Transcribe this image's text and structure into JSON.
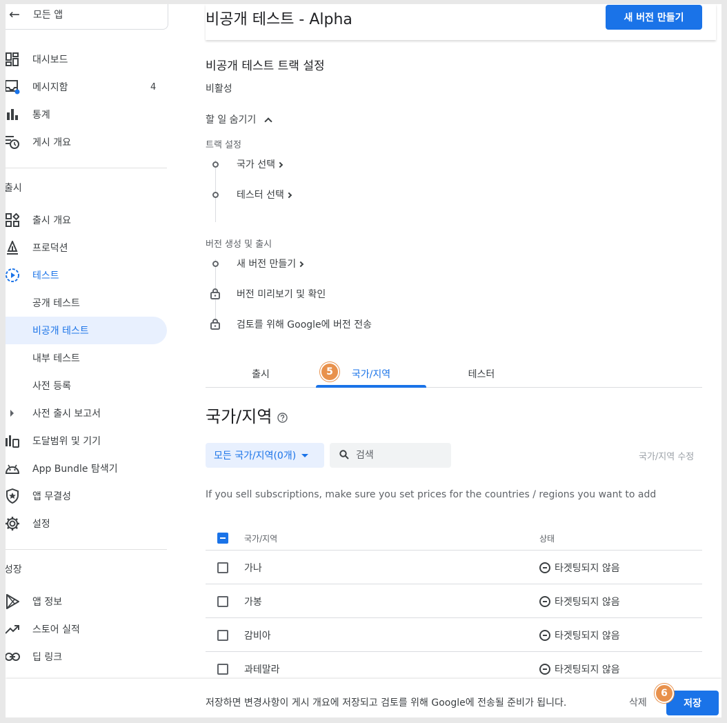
{
  "sidebar": {
    "back_label": "모든 앱",
    "items_top": [
      {
        "label": "대시보드",
        "icon": "dashboard-icon"
      },
      {
        "label": "메시지함",
        "icon": "inbox-icon",
        "badge": "4"
      },
      {
        "label": "통계",
        "icon": "bar-chart-icon"
      },
      {
        "label": "게시 개요",
        "icon": "publishing-overview-icon"
      }
    ],
    "section_release": "출시",
    "items_release": [
      {
        "label": "출시 개요",
        "icon": "release-overview-icon"
      },
      {
        "label": "프로덕션",
        "icon": "production-icon"
      },
      {
        "label": "테스트",
        "icon": "testing-icon"
      },
      {
        "label": "공개 테스트"
      },
      {
        "label": "비공개 테스트"
      },
      {
        "label": "내부 테스트"
      },
      {
        "label": "사전 등록"
      },
      {
        "label": "사전 출시 보고서"
      },
      {
        "label": "도달범위 및 기기",
        "icon": "reach-devices-icon"
      },
      {
        "label": "App Bundle 탐색기",
        "icon": "android-icon"
      },
      {
        "label": "앱 무결성",
        "icon": "shield-icon"
      },
      {
        "label": "설정",
        "icon": "gear-icon"
      }
    ],
    "section_grow": "성장",
    "items_grow": [
      {
        "label": "앱 정보",
        "icon": "play-icon"
      },
      {
        "label": "스토어 실적",
        "icon": "trending-icon"
      },
      {
        "label": "딥 링크",
        "icon": "link-icon"
      }
    ]
  },
  "header": {
    "title": "비공개 테스트 - Alpha",
    "new_release_button": "새 버전 만들기"
  },
  "track": {
    "title": "비공개 테스트 트랙 설정",
    "status": "비활성",
    "hide_todo": "할 일 숨기기",
    "group1": "트랙 설정",
    "step_countries": "국가 선택",
    "step_testers": "테스터 선택",
    "group2": "버전 생성 및 출시",
    "step_create": "새 버전 만들기",
    "step_preview": "버전 미리보기 및 확인",
    "step_send": "검토를 위해 Google에 버전 전송"
  },
  "tabs": [
    {
      "label": "출시"
    },
    {
      "label": "국가/지역"
    },
    {
      "label": "테스터"
    }
  ],
  "markers": {
    "tab": "5",
    "save": "6"
  },
  "countries": {
    "heading": "국가/지역",
    "filter_label": "모든 국가/지역(0개)",
    "search_placeholder": "검색",
    "edit_link": "국가/지역 수정",
    "info": "If you sell subscriptions, make sure you set prices for the countries / regions you want to add",
    "col_country": "국가/지역",
    "col_status": "상태",
    "rows": [
      {
        "country": "가나",
        "status": "타겟팅되지 않음"
      },
      {
        "country": "가봉",
        "status": "타겟팅되지 않음"
      },
      {
        "country": "감비아",
        "status": "타겟팅되지 않음"
      },
      {
        "country": "과테말라",
        "status": "타겟팅되지 않음"
      }
    ]
  },
  "footer": {
    "text": "저장하면 변경사항이 게시 개요에 저장되고 검토를 위해 Google에 전송될 준비가 됩니다.",
    "delete": "삭제",
    "save": "저장"
  },
  "colors": {
    "accent": "#1a73e8",
    "marker": "#e8914c",
    "selected_bg": "#e8f0fe"
  }
}
